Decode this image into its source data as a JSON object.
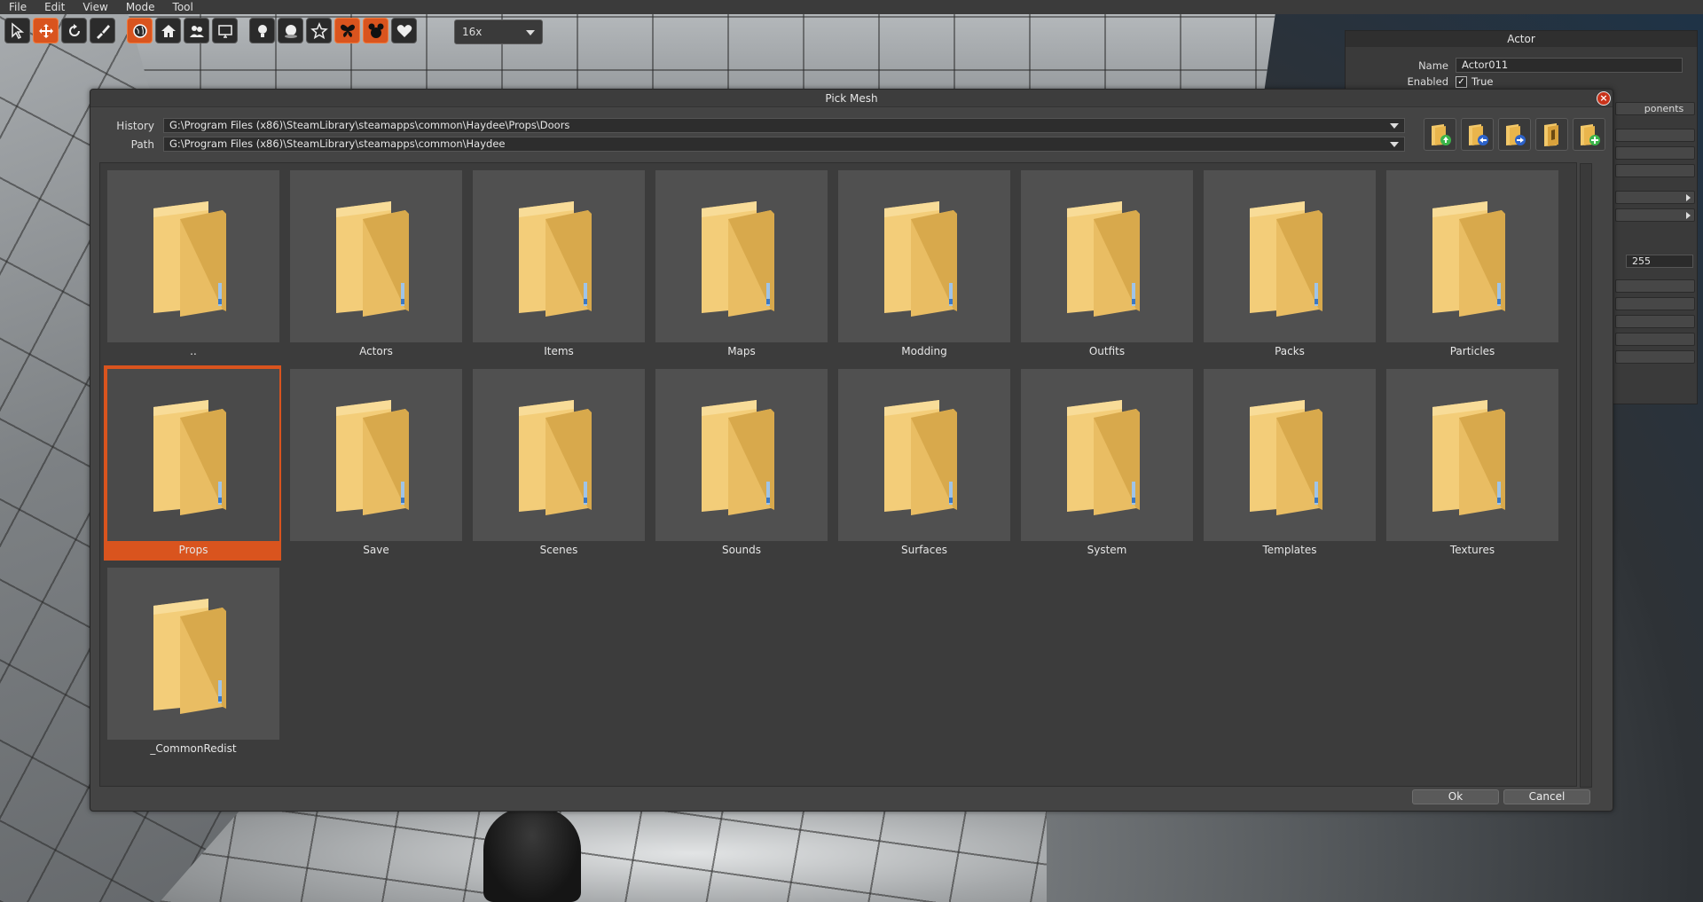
{
  "menu": [
    "File",
    "Edit",
    "View",
    "Mode",
    "Tool"
  ],
  "toolbar": {
    "zoom_value": "16x",
    "accent_color": "#d9541e"
  },
  "actor_panel": {
    "title": "Actor",
    "name_label": "Name",
    "name_value": "Actor011",
    "enabled_label": "Enabled",
    "enabled_value": "True",
    "components_label": "ponents",
    "value_255": "255"
  },
  "dialog": {
    "title": "Pick Mesh",
    "close_icon": "close-icon",
    "history_label": "History",
    "history_value": "G:\\Program Files (x86)\\SteamLibrary\\steamapps\\common\\Haydee\\Props\\Doors",
    "path_label": "Path",
    "path_value": "G:\\Program Files (x86)\\SteamLibrary\\steamapps\\common\\Haydee",
    "nav_icons": [
      "folder-up-icon",
      "folder-back-icon",
      "folder-forward-icon",
      "folder-open-icon",
      "folder-new-icon"
    ],
    "folders": [
      {
        "label": ".."
      },
      {
        "label": "Actors"
      },
      {
        "label": "Items"
      },
      {
        "label": "Maps"
      },
      {
        "label": "Modding"
      },
      {
        "label": "Outfits"
      },
      {
        "label": "Packs"
      },
      {
        "label": "Particles"
      },
      {
        "label": "Props",
        "selected": true
      },
      {
        "label": "Save"
      },
      {
        "label": "Scenes"
      },
      {
        "label": "Sounds"
      },
      {
        "label": "Surfaces"
      },
      {
        "label": "System"
      },
      {
        "label": "Templates"
      },
      {
        "label": "Textures"
      },
      {
        "label": "_CommonRedist"
      }
    ],
    "ok_label": "Ok",
    "cancel_label": "Cancel"
  }
}
